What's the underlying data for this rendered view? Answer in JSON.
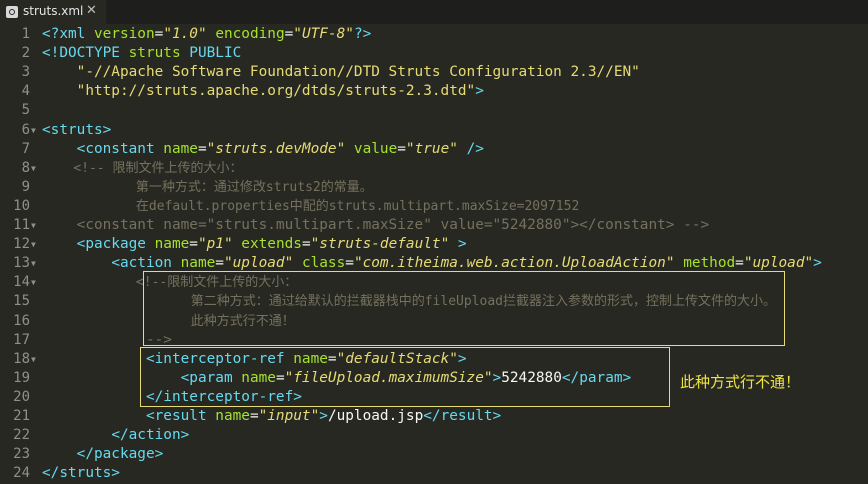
{
  "tab": {
    "title": "struts.xml",
    "close": "✕"
  },
  "lines": [
    {
      "n": "1",
      "fold": false,
      "indent": "",
      "segs": [
        {
          "c": "tag",
          "t": "<?xml "
        },
        {
          "c": "attr",
          "t": "version"
        },
        {
          "c": "t",
          "t": "="
        },
        {
          "c": "val",
          "t": "\"1.0\""
        },
        {
          "c": "t",
          "t": " "
        },
        {
          "c": "attr",
          "t": "encoding"
        },
        {
          "c": "t",
          "t": "="
        },
        {
          "c": "val",
          "t": "\"UTF-8\""
        },
        {
          "c": "tag",
          "t": "?>"
        }
      ]
    },
    {
      "n": "2",
      "fold": false,
      "indent": "",
      "segs": [
        {
          "c": "tag",
          "t": "<!DOCTYPE "
        },
        {
          "c": "attr",
          "t": "struts "
        },
        {
          "c": "kw",
          "t": "PUBLIC"
        }
      ]
    },
    {
      "n": "3",
      "fold": false,
      "indent": "    ",
      "segs": [
        {
          "c": "str",
          "t": "\"-//Apache Software Foundation//DTD Struts Configuration 2.3//EN\""
        }
      ]
    },
    {
      "n": "4",
      "fold": false,
      "indent": "    ",
      "segs": [
        {
          "c": "str",
          "t": "\"http://struts.apache.org/dtds/struts-2.3.dtd\""
        },
        {
          "c": "tag",
          "t": ">"
        }
      ]
    },
    {
      "n": "5",
      "fold": false,
      "indent": "",
      "segs": []
    },
    {
      "n": "6",
      "fold": true,
      "indent": "",
      "segs": [
        {
          "c": "tag",
          "t": "<struts>"
        }
      ]
    },
    {
      "n": "7",
      "fold": false,
      "indent": "    ",
      "segs": [
        {
          "c": "tag",
          "t": "<constant "
        },
        {
          "c": "attr",
          "t": "name"
        },
        {
          "c": "t",
          "t": "="
        },
        {
          "c": "val",
          "t": "\"struts.devMode\""
        },
        {
          "c": "t",
          "t": " "
        },
        {
          "c": "attr",
          "t": "value"
        },
        {
          "c": "t",
          "t": "="
        },
        {
          "c": "val",
          "t": "\"true\""
        },
        {
          "c": "t",
          "t": " "
        },
        {
          "c": "tag",
          "t": "/>"
        }
      ]
    },
    {
      "n": "8",
      "fold": true,
      "indent": "    ",
      "ch": true,
      "segs": [
        {
          "c": "com",
          "t": "<!-- 限制文件上传的大小："
        }
      ]
    },
    {
      "n": "9",
      "fold": false,
      "indent": "        ",
      "ch": true,
      "segs": [
        {
          "c": "com",
          "t": "    第一种方式：通过修改struts2的常量。"
        }
      ]
    },
    {
      "n": "10",
      "fold": false,
      "indent": "        ",
      "ch": true,
      "segs": [
        {
          "c": "com",
          "t": "    在default.properties中配的struts.multipart.maxSize=2097152"
        }
      ]
    },
    {
      "n": "11",
      "fold": true,
      "indent": "    ",
      "segs": [
        {
          "c": "com",
          "t": "<constant name=\"struts.multipart.maxSize\" value=\"5242880\"></constant> -->"
        }
      ]
    },
    {
      "n": "12",
      "fold": true,
      "indent": "    ",
      "segs": [
        {
          "c": "tag",
          "t": "<package "
        },
        {
          "c": "attr",
          "t": "name"
        },
        {
          "c": "t",
          "t": "="
        },
        {
          "c": "val",
          "t": "\"p1\""
        },
        {
          "c": "t",
          "t": " "
        },
        {
          "c": "attr",
          "t": "extends"
        },
        {
          "c": "t",
          "t": "="
        },
        {
          "c": "val",
          "t": "\"struts-default\""
        },
        {
          "c": "t",
          "t": " "
        },
        {
          "c": "tag",
          "t": ">"
        }
      ]
    },
    {
      "n": "13",
      "fold": true,
      "indent": "        ",
      "segs": [
        {
          "c": "tag",
          "t": "<action "
        },
        {
          "c": "attr",
          "t": "name"
        },
        {
          "c": "t",
          "t": "="
        },
        {
          "c": "val",
          "t": "\"upload\""
        },
        {
          "c": "t",
          "t": " "
        },
        {
          "c": "attr",
          "t": "class"
        },
        {
          "c": "t",
          "t": "="
        },
        {
          "c": "val",
          "t": "\"com.itheima.web.action.UploadAction\""
        },
        {
          "c": "t",
          "t": " "
        },
        {
          "c": "attr",
          "t": "method"
        },
        {
          "c": "t",
          "t": "="
        },
        {
          "c": "val",
          "t": "\"upload\""
        },
        {
          "c": "tag",
          "t": ">"
        }
      ]
    },
    {
      "n": "14",
      "fold": true,
      "indent": "            ",
      "ch": true,
      "segs": [
        {
          "c": "com",
          "t": "<!--限制文件上传的大小："
        }
      ]
    },
    {
      "n": "15",
      "fold": false,
      "indent": "                ",
      "ch": true,
      "segs": [
        {
          "c": "com",
          "t": "   第二种方式：通过给默认的拦截器栈中的fileUpload拦截器注入参数的形式，控制上传文件的大小。"
        }
      ]
    },
    {
      "n": "16",
      "fold": false,
      "indent": "                ",
      "ch": true,
      "segs": [
        {
          "c": "com",
          "t": "   此种方式行不通！"
        }
      ]
    },
    {
      "n": "17",
      "fold": false,
      "indent": "            ",
      "segs": [
        {
          "c": "com",
          "t": "-->"
        }
      ]
    },
    {
      "n": "18",
      "fold": true,
      "indent": "            ",
      "segs": [
        {
          "c": "tag",
          "t": "<interceptor-ref "
        },
        {
          "c": "attr",
          "t": "name"
        },
        {
          "c": "t",
          "t": "="
        },
        {
          "c": "val",
          "t": "\"defaultStack\""
        },
        {
          "c": "tag",
          "t": ">"
        }
      ]
    },
    {
      "n": "19",
      "fold": false,
      "indent": "                ",
      "segs": [
        {
          "c": "tag",
          "t": "<param "
        },
        {
          "c": "attr",
          "t": "name"
        },
        {
          "c": "t",
          "t": "="
        },
        {
          "c": "val",
          "t": "\"fileUpload.maximumSize\""
        },
        {
          "c": "tag",
          "t": ">"
        },
        {
          "c": "t",
          "t": "5242880"
        },
        {
          "c": "tag",
          "t": "</param>"
        }
      ]
    },
    {
      "n": "20",
      "fold": false,
      "indent": "            ",
      "segs": [
        {
          "c": "tag",
          "t": "</interceptor-ref>"
        }
      ]
    },
    {
      "n": "21",
      "fold": false,
      "indent": "            ",
      "segs": [
        {
          "c": "tag",
          "t": "<result "
        },
        {
          "c": "attr",
          "t": "name"
        },
        {
          "c": "t",
          "t": "="
        },
        {
          "c": "val",
          "t": "\"input\""
        },
        {
          "c": "tag",
          "t": ">"
        },
        {
          "c": "t",
          "t": "/upload.jsp"
        },
        {
          "c": "tag",
          "t": "</result>"
        }
      ]
    },
    {
      "n": "22",
      "fold": false,
      "indent": "        ",
      "segs": [
        {
          "c": "tag",
          "t": "</action>"
        }
      ]
    },
    {
      "n": "23",
      "fold": false,
      "indent": "    ",
      "segs": [
        {
          "c": "tag",
          "t": "</package>"
        }
      ]
    },
    {
      "n": "24",
      "fold": false,
      "indent": "",
      "segs": [
        {
          "c": "tag",
          "t": "</struts>"
        }
      ]
    }
  ],
  "annotation": "此种方式行不通！"
}
